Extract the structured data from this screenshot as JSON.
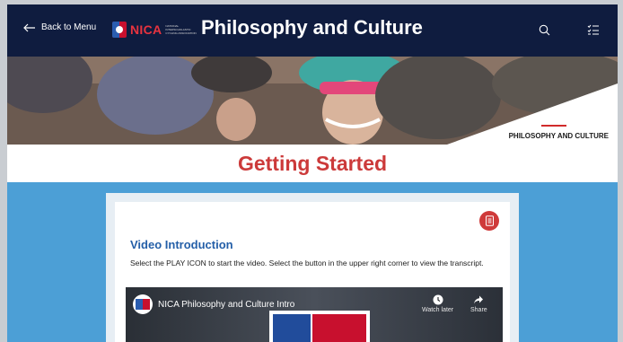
{
  "header": {
    "back_label": "Back to Menu",
    "logo_text": "NICA",
    "logo_subtitle": "National Interscholastic Cycling Association",
    "title": "Philosophy and Culture",
    "icons": [
      "search-icon",
      "checklist-icon"
    ]
  },
  "hero": {
    "section_label": "PHILOSOPHY AND CULTURE"
  },
  "main": {
    "title": "Getting Started",
    "card": {
      "section_title": "Video Introduction",
      "instructions": "Select the PLAY ICON to start the video.  Select the button in the upper right corner to view the transcript.",
      "transcript_icon": "document-icon",
      "video": {
        "title": "NICA Philosophy and Culture Intro",
        "watch_later_label": "Watch later",
        "share_label": "Share"
      }
    }
  },
  "colors": {
    "header_bg": "#0f1c3f",
    "title_red": "#cc3a3a",
    "content_blue": "#4c9fd6",
    "section_title_blue": "#245fa8",
    "accent_red": "#cf3a3a"
  }
}
